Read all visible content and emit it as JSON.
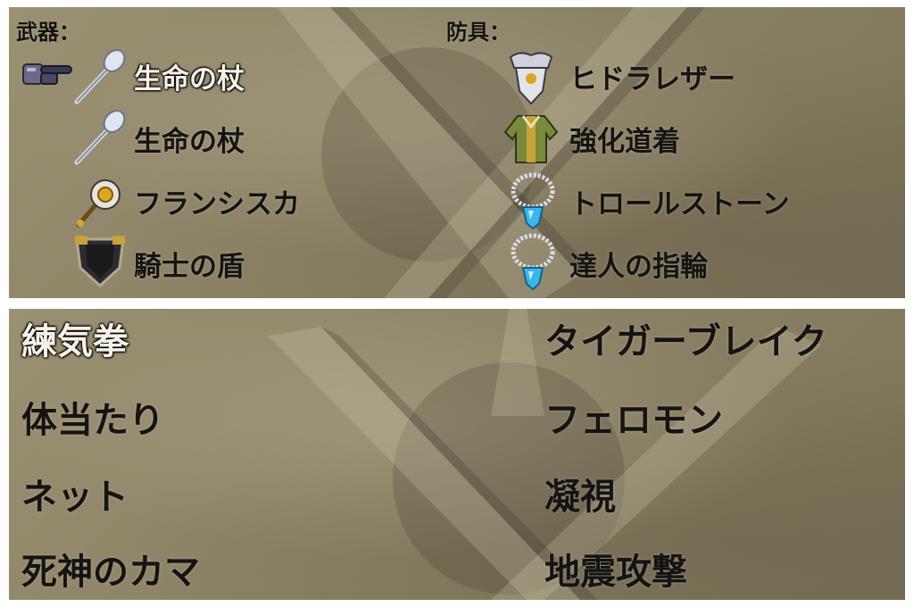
{
  "equipment": {
    "weapons_header": "武器：",
    "armor_header": "防具：",
    "weapons": [
      {
        "name": "生命の杖",
        "icon": "staff-icon"
      },
      {
        "name": "生命の杖",
        "icon": "staff-icon"
      },
      {
        "name": "フランシスカ",
        "icon": "axe-icon"
      },
      {
        "name": "騎士の盾",
        "icon": "shield-icon"
      }
    ],
    "armor": [
      {
        "name": "ヒドラレザー",
        "icon": "helmet-armor-icon"
      },
      {
        "name": "強化道着",
        "icon": "robe-icon"
      },
      {
        "name": "トロールストーン",
        "icon": "necklace-icon"
      },
      {
        "name": "達人の指輪",
        "icon": "necklace-icon"
      }
    ],
    "cursor_icon": "pointing-gauntlet-icon"
  },
  "skills": {
    "left": [
      "練気拳",
      "体当たり",
      "ネット",
      "死神のカマ"
    ],
    "right": [
      "タイガーブレイク",
      "フェロモン",
      "凝視",
      "地震攻撃"
    ]
  },
  "colors": {
    "panel_bg": "#8d8467",
    "text_dark": "#151412",
    "text_selected": "#f3f1e8",
    "gem_blue": "#3bb6ea"
  }
}
